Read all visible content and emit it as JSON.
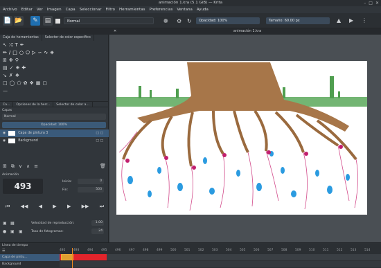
{
  "window": {
    "title": "animación 1.kra (5.1 GiB) — Krita"
  },
  "menu": [
    "Archivo",
    "Editar",
    "Ver",
    "Imagen",
    "Capa",
    "Seleccionar",
    "Filtro",
    "Herramientas",
    "Preferencias",
    "Ventana",
    "Ayuda"
  ],
  "toolbar": {
    "blend_mode": "Normal",
    "opacity": "Opacidad: 100%",
    "size": "Tamaño: 60.00 px"
  },
  "tabs": {
    "document": "animación 1.kra"
  },
  "docker_tabs": [
    "Caja de herramientas",
    "Selector de color específico"
  ],
  "layers": {
    "tabs": [
      "Ca...",
      "Opciones de la herr...",
      "Selector de color a..."
    ],
    "header_label": "Capas",
    "blend": "Normal",
    "opacity": "Opacidad: 100%",
    "items": [
      {
        "name": "Capa de pintura 3",
        "selected": true
      },
      {
        "name": "Background",
        "selected": false
      }
    ]
  },
  "animation": {
    "header": "Animación",
    "current_frame": "493",
    "start_label": "Inicio:",
    "start_value": "0",
    "end_label": "Fin:",
    "end_value": "503",
    "speed_label": "Velocidad de reproducción:",
    "speed_value": "1.00",
    "fps_label": "Tasa de fotogramas:",
    "fps_value": "24"
  },
  "timeline": {
    "title": "Línea de tiempo",
    "frames": [
      "492",
      "493",
      "494",
      "495",
      "496",
      "497",
      "498",
      "499",
      "500",
      "501",
      "502",
      "503",
      "504",
      "505",
      "506",
      "507",
      "508",
      "509",
      "510",
      "511",
      "512",
      "513",
      "514"
    ],
    "layers": [
      "Capa de pintu...",
      "Background"
    ]
  }
}
